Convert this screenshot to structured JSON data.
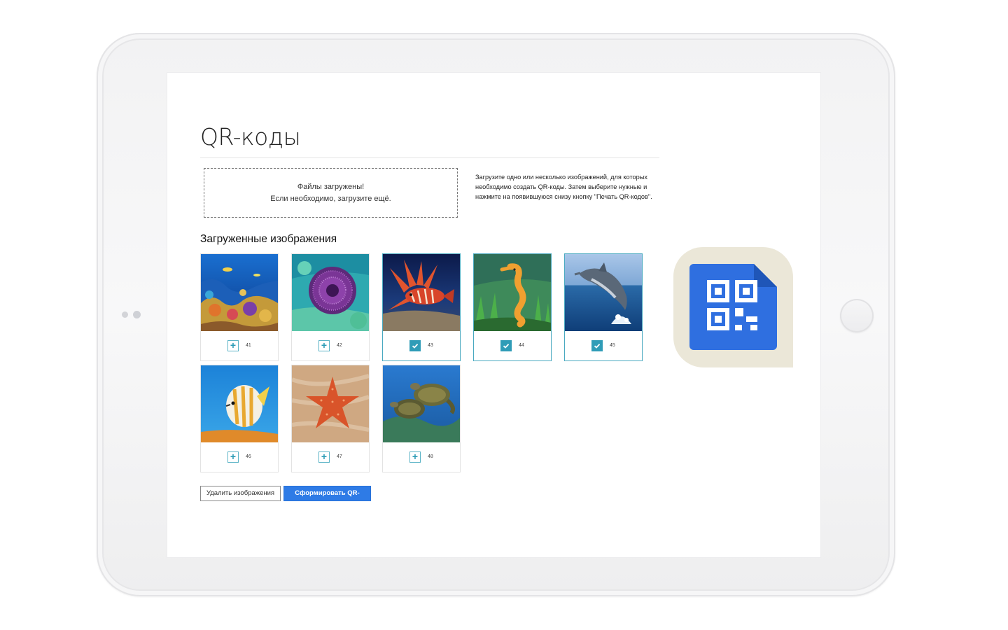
{
  "page": {
    "title": "QR-коды",
    "dropzone": {
      "line1": "Файлы загружены!",
      "line2": "Если необходимо, загрузите ещё."
    },
    "help_text": "Загрузите одно или несколько изображений, для которых необходимо создать QR-коды. Затем выберите нужные и нажмите на появившуюся снизу кнопку \"Печать QR-кодов\".",
    "section_title": "Загруженные изображения",
    "images": [
      {
        "number": "41",
        "subject": "coral-reef",
        "selected": false
      },
      {
        "number": "42",
        "subject": "sea-urchin",
        "selected": false
      },
      {
        "number": "43",
        "subject": "lionfish",
        "selected": true
      },
      {
        "number": "44",
        "subject": "seahorse",
        "selected": true
      },
      {
        "number": "45",
        "subject": "dolphin",
        "selected": true
      },
      {
        "number": "46",
        "subject": "butterflyfish",
        "selected": false
      },
      {
        "number": "47",
        "subject": "starfish",
        "selected": false
      },
      {
        "number": "48",
        "subject": "sea-turtles",
        "selected": false
      }
    ],
    "buttons": {
      "delete": "Удалить изображения",
      "generate": "Сформировать QR-коды"
    }
  },
  "colors": {
    "accent": "#2e7be6",
    "checkbox": "#2f9cb7",
    "icon_bg": "#ebe7d8",
    "icon_doc": "#2f6fe0"
  },
  "icons": [
    "plus-icon",
    "check-icon",
    "qr-document-icon"
  ]
}
